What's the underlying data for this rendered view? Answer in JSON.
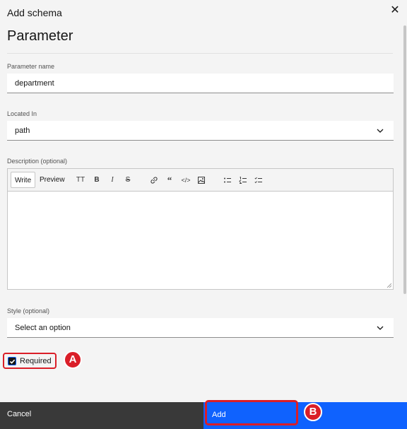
{
  "modal": {
    "header_label": "Add schema",
    "title": "Parameter",
    "close_icon": "close-icon"
  },
  "form": {
    "parameter_name": {
      "label": "Parameter name",
      "value": "department"
    },
    "located_in": {
      "label": "Located In",
      "value": "path"
    },
    "description": {
      "label": "Description (optional)",
      "tabs": [
        "Write",
        "Preview"
      ],
      "active_tab": "Write",
      "toolbar_icons": [
        "text-size-icon",
        "bold-icon",
        "italic-icon",
        "strikethrough-icon",
        "link-icon",
        "quote-icon",
        "code-icon",
        "image-icon",
        "bulleted-list-icon",
        "numbered-list-icon",
        "task-list-icon"
      ],
      "value": ""
    },
    "style": {
      "label": "Style (optional)",
      "value": "Select an option"
    },
    "required": {
      "label": "Required",
      "checked": true
    }
  },
  "footer": {
    "cancel_label": "Cancel",
    "add_label": "Add"
  },
  "annotations": {
    "marker_a": "A",
    "marker_b": "B"
  },
  "colors": {
    "primary": "#0f62fe",
    "secondary_button": "#393939",
    "highlight": "#da1e28",
    "background": "#f4f4f4"
  }
}
